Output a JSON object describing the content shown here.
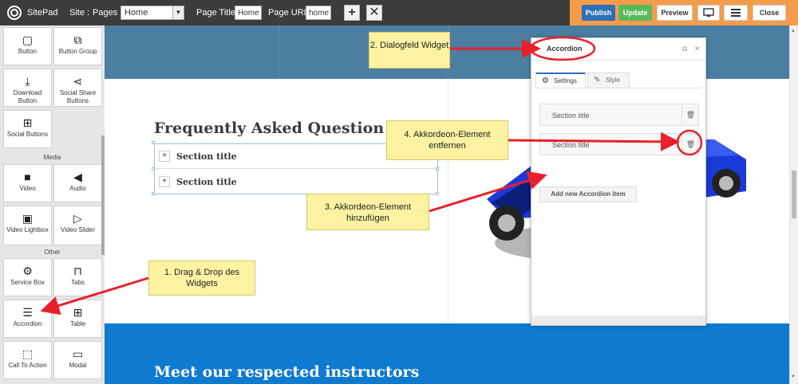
{
  "topbar": {
    "brand": "SitePad",
    "site_label": "Site :",
    "pages_label": "Pages :",
    "pages_value": "Home",
    "page_title_label": "Page Title:",
    "page_title_value": "Home",
    "page_url_label": "Page URL:",
    "page_url_value": "home",
    "add_icon": "plus-icon",
    "remove_icon": "x-icon",
    "buttons": {
      "publish": "Publish",
      "update": "Update",
      "preview": "Preview",
      "close": "Close"
    },
    "colors": {
      "bar": "#3c3c3c",
      "orange": "#f39c4b",
      "publish": "#2d6fb8",
      "update": "#5cb85c"
    }
  },
  "widgets": [
    {
      "label": "Button",
      "icon": "square-icon"
    },
    {
      "label": "Button Group",
      "icon": "stacked-squares-icon"
    },
    {
      "label": "Download Button",
      "icon": "download-icon"
    },
    {
      "label": "Social Share Buttons",
      "icon": "share-icon"
    },
    {
      "label": "Social Buttons",
      "icon": "social-grid-icon"
    },
    {
      "label": "Video",
      "icon": "video-camera-icon"
    },
    {
      "label": "Audio",
      "icon": "speaker-icon"
    },
    {
      "label": "Video Lightbox",
      "icon": "film-icon"
    },
    {
      "label": "Video Slider",
      "icon": "video-slider-icon"
    },
    {
      "label": "Service Box",
      "icon": "gear-icon"
    },
    {
      "label": "Tabs",
      "icon": "tabs-icon"
    },
    {
      "label": "Accordion",
      "icon": "accordion-icon"
    },
    {
      "label": "Table",
      "icon": "table-icon"
    },
    {
      "label": "Call To Action",
      "icon": "cursor-select-icon"
    },
    {
      "label": "Modal",
      "icon": "modal-window-icon"
    }
  ],
  "sections": {
    "media": "Media",
    "other": "Other"
  },
  "page": {
    "faq_title": "Frequently Asked Question",
    "accordion_rows": [
      "Section title",
      "Section title"
    ],
    "instructors_title": "Meet our respected instructors",
    "colors": {
      "hero": "#4a7fa1",
      "blue_section": "#0e7ad0"
    }
  },
  "dialog": {
    "title": "Accordion",
    "tabs": {
      "settings": "Settings",
      "style": "Style"
    },
    "items": [
      "Section title",
      "Section title"
    ],
    "add_button": "Add new Accordion item"
  },
  "callouts": {
    "c1": "1. Drag & Drop des Widgets",
    "c2": "2. Dialogfeld Widget",
    "c3": "3. Akkordeon-Element hinzufügen",
    "c4": "4. Akkordeon-Element entfernen",
    "colors": {
      "fill": "#fcf2a2",
      "arrow": "#e8202a"
    }
  }
}
